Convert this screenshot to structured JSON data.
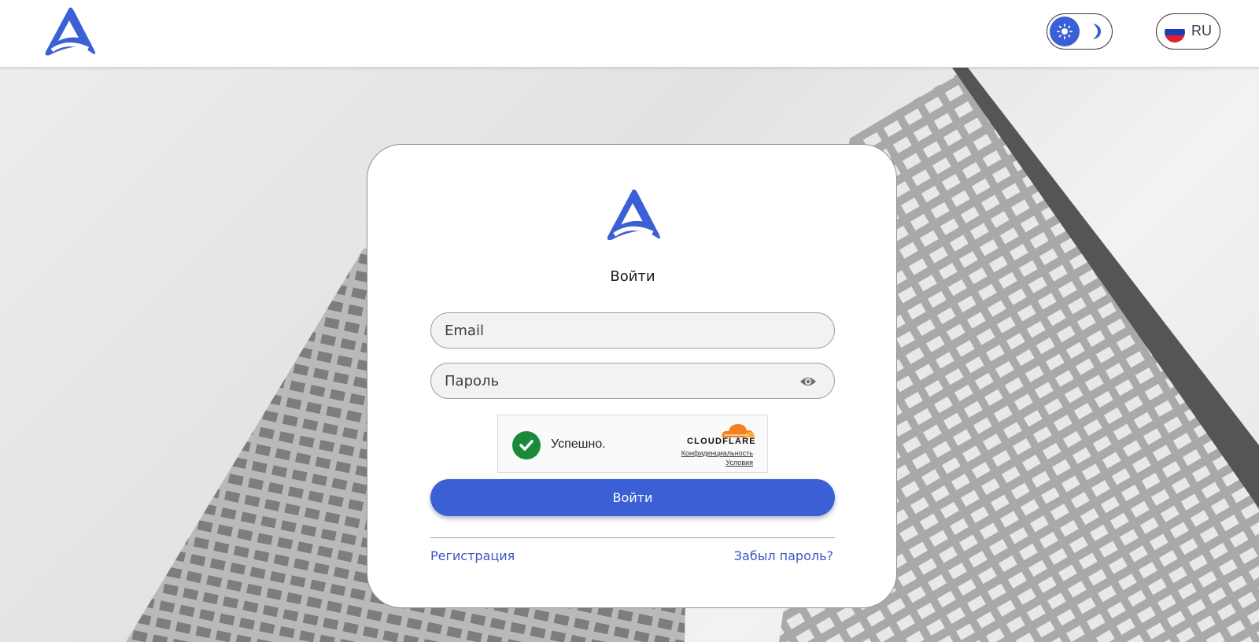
{
  "header": {
    "theme_toggle": {
      "active": "light",
      "icons": [
        "sun-icon",
        "moon-icon"
      ]
    },
    "language": {
      "code": "RU",
      "flag": "russia-flag-icon"
    }
  },
  "colors": {
    "brand": "#3b5fd4",
    "link": "#3b55c4",
    "success": "#1a8a3a",
    "cloudflare_orange": "#f48120"
  },
  "login": {
    "title": "Войти",
    "email_placeholder": "Email",
    "password_placeholder": "Пароль",
    "captcha": {
      "status": "Успешно.",
      "provider": "CLOUDFLARE",
      "privacy_link": "Конфиденциальность",
      "terms_link": "Условия"
    },
    "submit_label": "Войти",
    "register_link": "Регистрация",
    "forgot_link": "Забыл пароль?"
  }
}
